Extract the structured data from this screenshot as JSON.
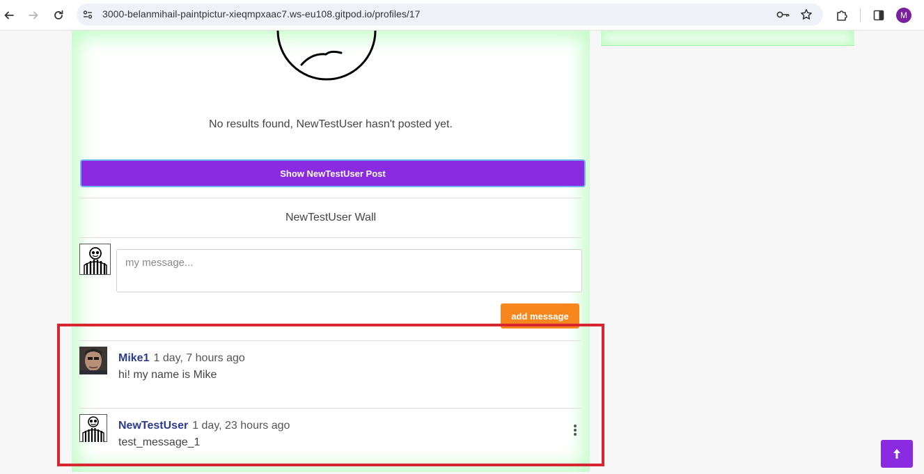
{
  "browser": {
    "url": "3000-belanmihail-paintpictur-xieqmpxaac7.ws-eu108.gitpod.io/profiles/17",
    "profile_initial": "M"
  },
  "profile": {
    "no_results": "No results found, NewTestUser hasn't posted yet.",
    "show_posts_label": "Show NewTestUser Post",
    "wall_title": "NewTestUser Wall",
    "message_placeholder": "my message...",
    "add_message_label": "add message"
  },
  "messages": [
    {
      "author": "Mike1",
      "time": "1 day, 7 hours ago",
      "text": "hi! my name is Mike"
    },
    {
      "author": "NewTestUser",
      "time": "1 day, 23 hours ago",
      "text": "test_message_1"
    }
  ],
  "colors": {
    "primary": "#8a2be2",
    "accent_orange": "#f7861c",
    "author_link": "#2b3a8f",
    "card_glow": "#c4fcc8",
    "highlight": "#d7262f"
  },
  "icons": [
    "back-arrow-icon",
    "forward-arrow-icon",
    "reload-icon",
    "site-info-icon",
    "key-icon",
    "star-icon",
    "extensions-icon",
    "side-panel-icon",
    "sad-face-illustration",
    "kebab-menu-icon",
    "arrow-up-icon"
  ]
}
